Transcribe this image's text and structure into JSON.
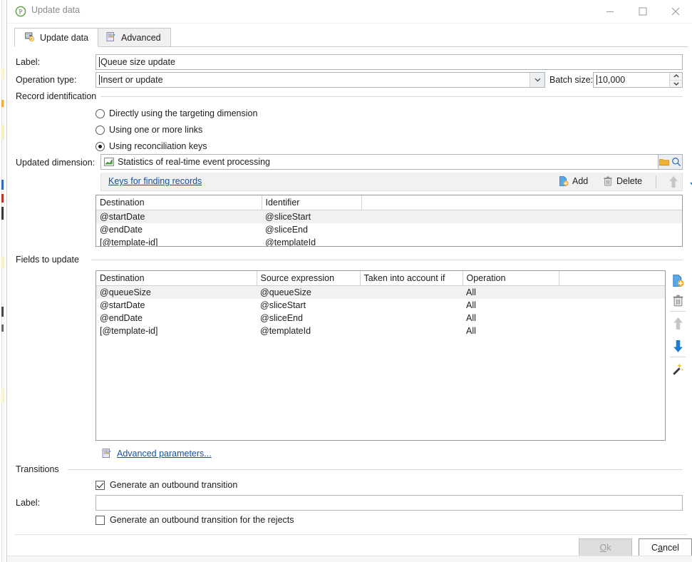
{
  "window": {
    "title": "Update data",
    "icon": "app-icon",
    "minimize": "minimize-icon",
    "maximize": "maximize-icon",
    "close": "close-icon"
  },
  "tabs": [
    {
      "label": "Update data",
      "icon": "update-data-icon",
      "active": true
    },
    {
      "label": "Advanced",
      "icon": "advanced-icon",
      "active": false
    }
  ],
  "form": {
    "label_caption": "Label:",
    "label_value": "Queue size update",
    "operation_type_caption": "Operation type:",
    "operation_type_value": "Insert or update",
    "batch_size_caption": "Batch size:",
    "batch_size_value": "10,000"
  },
  "record_identification": {
    "group_title": "Record identification",
    "options": [
      {
        "label": "Directly using the targeting dimension",
        "selected": false
      },
      {
        "label": "Using one or more links",
        "selected": false
      },
      {
        "label": "Using reconciliation keys",
        "selected": true
      }
    ],
    "updated_dimension_caption": "Updated dimension:",
    "updated_dimension_value": "Statistics of real-time event processing",
    "dimension_icon": "chart-dimension-icon",
    "browse_icon": "folder-icon",
    "search_icon": "search-icon"
  },
  "keys_panel": {
    "title": "Keys for finding records",
    "add_label": "Add",
    "delete_label": "Delete",
    "add_icon": "add-icon",
    "delete_icon": "trash-icon",
    "move_up_icon": "arrow-up-icon",
    "move_down_icon": "arrow-down-icon",
    "columns": [
      "Destination",
      "Identifier",
      ""
    ],
    "rows": [
      [
        "@startDate",
        "@sliceStart",
        ""
      ],
      [
        "@endDate",
        "@sliceEnd",
        ""
      ],
      [
        "[@template-id]",
        "@templateId",
        ""
      ]
    ]
  },
  "fields_panel": {
    "group_title": "Fields to update",
    "columns": [
      "Destination",
      "Source expression",
      "Taken into account if",
      "Operation",
      ""
    ],
    "rows": [
      [
        "@queueSize",
        "@queueSize",
        "",
        "All",
        ""
      ],
      [
        "@startDate",
        "@sliceStart",
        "",
        "All",
        ""
      ],
      [
        "@endDate",
        "@sliceEnd",
        "",
        "All",
        ""
      ],
      [
        "[@template-id]",
        "@templateId",
        "",
        "All",
        ""
      ]
    ],
    "tools": [
      "add-icon",
      "trash-icon",
      "arrow-up-icon",
      "arrow-down-icon",
      "magic-wand-icon"
    ],
    "advanced_parameters_label": "Advanced parameters...",
    "advanced_parameters_icon": "advanced-parameters-icon"
  },
  "transitions": {
    "group_title": "Transitions",
    "outbound_label": "Generate an outbound transition",
    "outbound_checked": true,
    "label_caption": "Label:",
    "label_value": "",
    "rejects_label": "Generate an outbound transition for the rejects",
    "rejects_checked": false
  },
  "footer": {
    "ok_label": "Ok",
    "ok_mnemonic": "O",
    "ok_enabled": false,
    "cancel_label": "Cancel",
    "cancel_mnemonic": "a"
  },
  "colors": {
    "accent_blue": "#1a7fd4",
    "link": "#1450a0",
    "panel_header": "#f1f1f1",
    "grid_border": "#9a9a9a"
  }
}
